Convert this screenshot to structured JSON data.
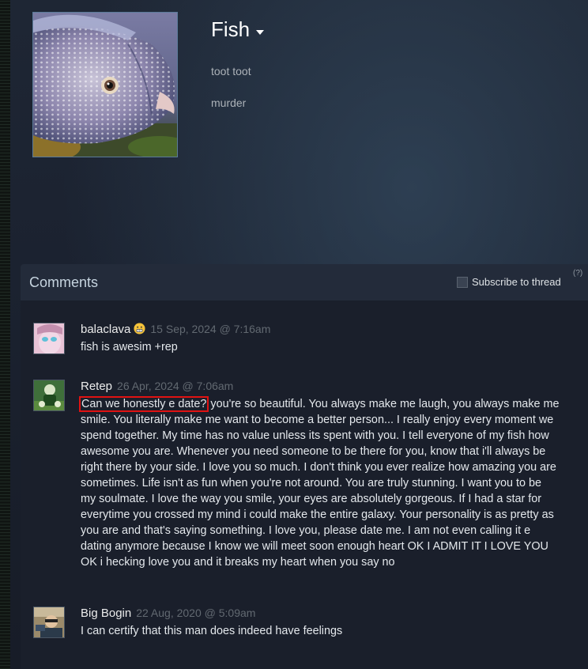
{
  "profile": {
    "name": "Fish",
    "summary_lines": [
      "toot toot",
      "murder"
    ],
    "avatar_icon": "fish-photo"
  },
  "comments_panel": {
    "title": "Comments",
    "subscribe_label": "Subscribe to thread",
    "help_label": "(?)"
  },
  "comments": [
    {
      "author": "balaclava",
      "emoji_icon": "grimace-emoji-icon",
      "timestamp": "15 Sep, 2024 @ 7:16am",
      "text": "fish is awesim +rep"
    },
    {
      "author": "Retep",
      "timestamp": "26 Apr, 2024 @ 7:06am",
      "highlight": "Can we honestly e date?",
      "text": " you're so beautiful. You always make me laugh, you always make me smile. You literally make me want to become a better person... I really enjoy every moment we spend together. My time has no value unless its spent with you. I tell everyone of my fish how awesome you are. Whenever you need someone to be there for you, know that i'll always be right there by your side. I love you so much. I don't think you ever realize how amazing you are sometimes. Life isn't as fun when you're not around. You are truly stunning. I want you to be my soulmate. I love the way you smile, your eyes are absolutely gorgeous. If I had a star for everytime you crossed my mind i could make the entire galaxy. Your personality is as pretty as you are and that's saying something. I love you, please date me. I am not even calling it e dating anymore because I know we will meet soon enough heart OK I ADMIT IT I LOVE YOU OK i hecking love you and it breaks my heart when you say no"
    },
    {
      "author": "Big Bogin",
      "timestamp": "22 Aug, 2020 @ 5:09am",
      "text": "I can certify that this man does indeed have feelings"
    }
  ],
  "colors": {
    "background": "#1b2130",
    "panel": "#1a1f2b",
    "highlight_box": "#e01212",
    "timestamp": "#626971"
  }
}
